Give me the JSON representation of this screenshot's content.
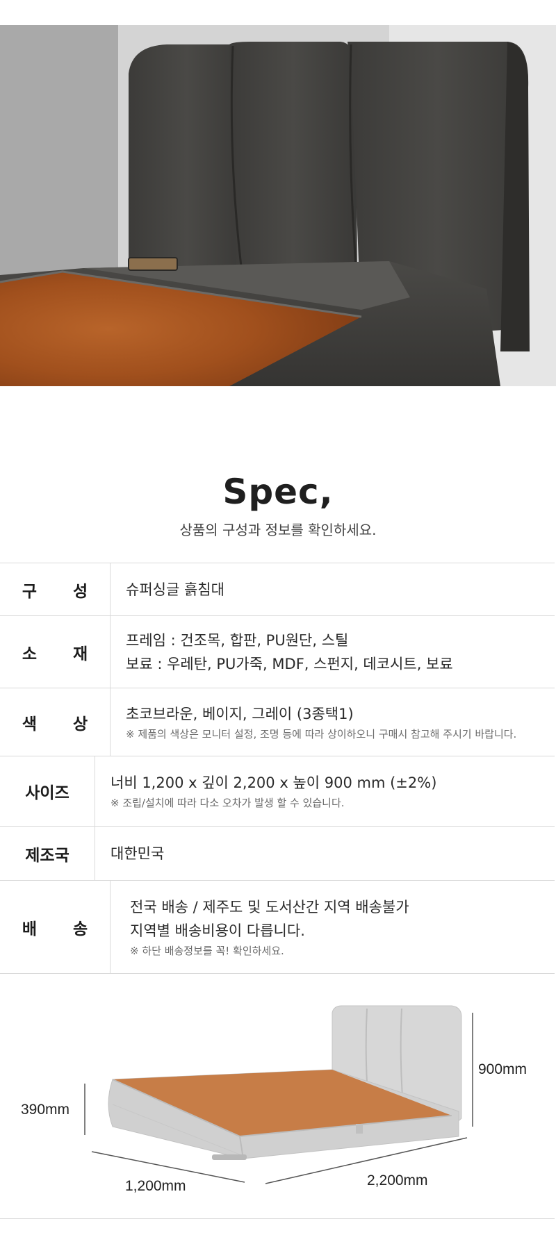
{
  "spec": {
    "title": "Spec,",
    "subtitle": "상품의 구성과 정보를 확인하세요."
  },
  "rows": [
    {
      "label": "구 성",
      "lines": [
        "슈퍼싱글 흙침대"
      ],
      "notes": []
    },
    {
      "label": "소 재",
      "lines": [
        "프레임 : 건조목, 합판, PU원단, 스틸",
        "보료 : 우레탄, PU가죽, MDF, 스펀지, 데코시트, 보료"
      ],
      "notes": []
    },
    {
      "label": "색 상",
      "lines": [
        "초코브라운, 베이지, 그레이 (3종택1)"
      ],
      "notes": [
        "※ 제품의 색상은 모니터 설정, 조명 등에 따라 상이하오니 구매시 참고해 주시기 바랍니다."
      ]
    },
    {
      "label": "사이즈",
      "lines": [
        "너비 1,200 x 깊이 2,200 x 높이 900 mm (±2%)"
      ],
      "notes": [
        "※ 조립/설치에 따라 다소 오차가 발생 할 수 있습니다."
      ]
    },
    {
      "label": "제조국",
      "lines": [
        "대한민국"
      ],
      "notes": []
    },
    {
      "label": "배 송",
      "lines": [
        "전국 배송 / 제주도 및 도서산간 지역 배송불가",
        "지역별 배송비용이 다릅니다."
      ],
      "notes": [
        "※ 하단 배송정보를 꼭! 확인하세요."
      ]
    }
  ],
  "dimensions": {
    "headboard_height": "900mm",
    "side_height": "390mm",
    "width": "1,200mm",
    "depth": "2,200mm"
  }
}
